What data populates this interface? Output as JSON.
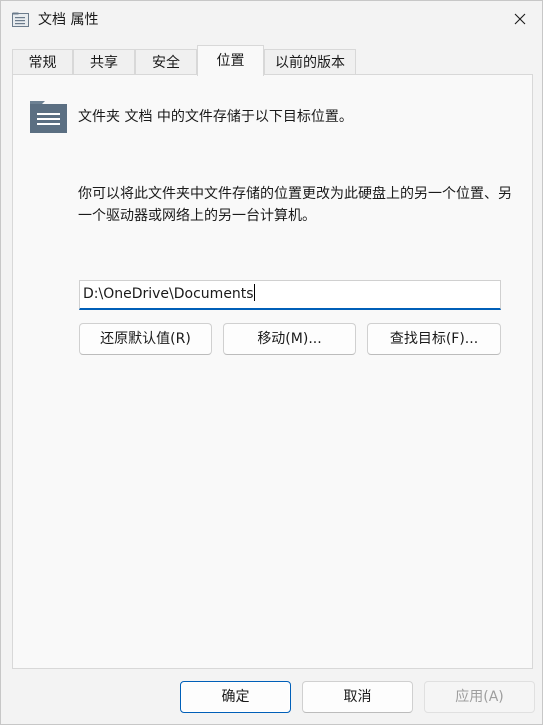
{
  "window": {
    "title": "文档 属性",
    "close_icon": "close-icon"
  },
  "tabs": [
    {
      "label": "常规",
      "active": false
    },
    {
      "label": "共享",
      "active": false
    },
    {
      "label": "安全",
      "active": false
    },
    {
      "label": "位置",
      "active": true
    },
    {
      "label": "以前的版本",
      "active": false
    }
  ],
  "location": {
    "folder_icon": "folder-icon",
    "description": "文件夹 文档 中的文件存储于以下目标位置。",
    "instructions": "你可以将此文件夹中文件存储的位置更改为此硬盘上的另一个位置、另一个驱动器或网络上的另一台计算机。",
    "path_value": "D:\\OneDrive\\Documents",
    "restore_default_label": "还原默认值(R)",
    "move_label": "移动(M)...",
    "find_target_label": "查找目标(F)..."
  },
  "footer": {
    "ok_label": "确定",
    "cancel_label": "取消",
    "apply_label": "应用(A)",
    "apply_enabled": false
  },
  "colors": {
    "accent": "#005fb8",
    "folder_blue": "#5b6f82"
  }
}
